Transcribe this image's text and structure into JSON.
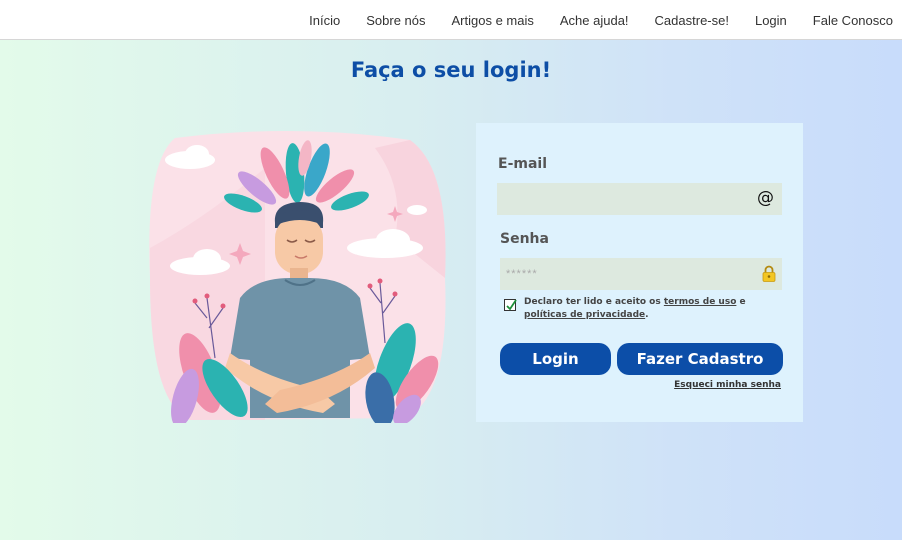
{
  "nav": {
    "items": [
      "Início",
      "Sobre nós",
      "Artigos e mais",
      "Ache ajuda!",
      "Cadastre-se!",
      "Login",
      "Fale Conosco"
    ]
  },
  "page": {
    "title": "Faça o seu login!"
  },
  "form": {
    "email_label": "E-mail",
    "email_value": "",
    "email_icon": "at-icon",
    "password_label": "Senha",
    "password_placeholder": "******",
    "password_icon": "lock-icon",
    "terms_prefix": "Declaro ter lido e aceito os ",
    "terms_link": "termos de uso",
    "terms_middle": " e ",
    "privacy_link": "políticas de privacidade",
    "terms_suffix": ".",
    "terms_checked": true,
    "login_button": "Login",
    "register_button": "Fazer Cadastro",
    "forgot_link": "Esqueci minha senha"
  },
  "colors": {
    "accent": "#0c4ea8",
    "panel": "#def2fd",
    "field": "#dde9df"
  }
}
